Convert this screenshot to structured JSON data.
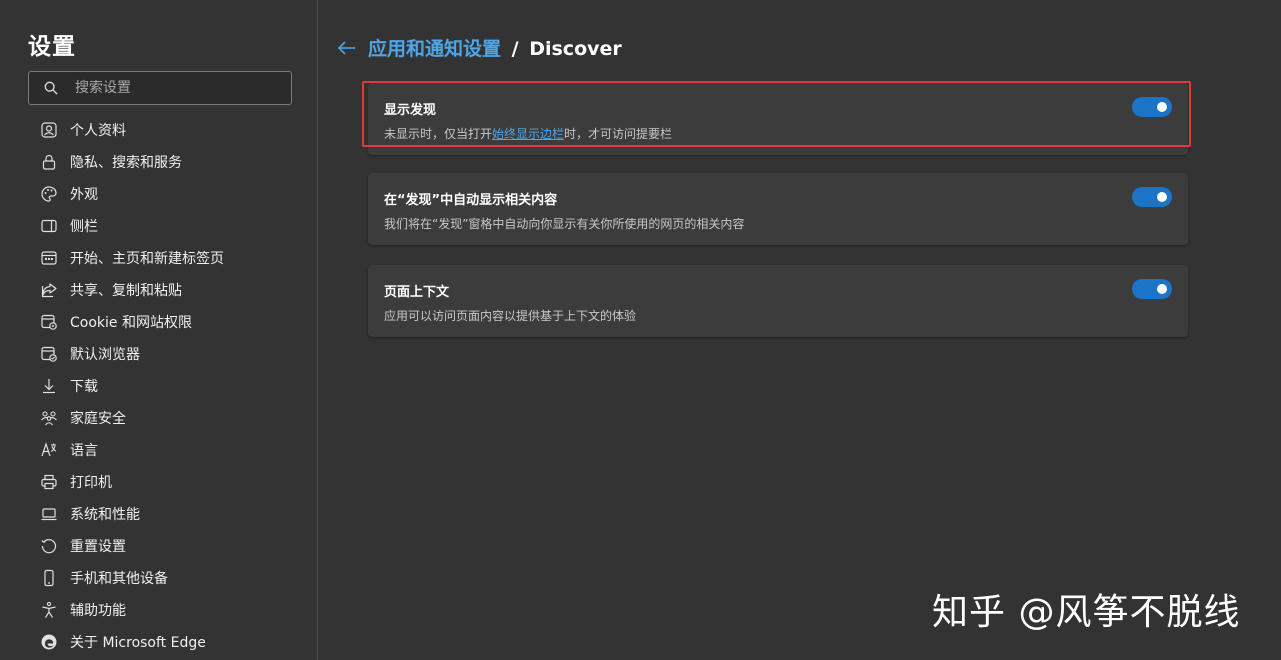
{
  "sidebar": {
    "title": "设置",
    "search": {
      "placeholder": "搜索设置",
      "value": ""
    },
    "items": [
      {
        "label": "个人资料",
        "icon": "profile-icon"
      },
      {
        "label": "隐私、搜索和服务",
        "icon": "lock-icon"
      },
      {
        "label": "外观",
        "icon": "palette-icon"
      },
      {
        "label": "侧栏",
        "icon": "sidebar-icon"
      },
      {
        "label": "开始、主页和新建标签页",
        "icon": "home-icon"
      },
      {
        "label": "共享、复制和粘贴",
        "icon": "share-icon"
      },
      {
        "label": "Cookie 和网站权限",
        "icon": "cookie-icon"
      },
      {
        "label": "默认浏览器",
        "icon": "browser-icon"
      },
      {
        "label": "下载",
        "icon": "download-icon"
      },
      {
        "label": "家庭安全",
        "icon": "family-icon"
      },
      {
        "label": "语言",
        "icon": "language-icon"
      },
      {
        "label": "打印机",
        "icon": "printer-icon"
      },
      {
        "label": "系统和性能",
        "icon": "laptop-icon"
      },
      {
        "label": "重置设置",
        "icon": "reset-icon"
      },
      {
        "label": "手机和其他设备",
        "icon": "phone-icon"
      },
      {
        "label": "辅助功能",
        "icon": "accessibility-icon"
      },
      {
        "label": "关于 Microsoft Edge",
        "icon": "edge-icon"
      }
    ]
  },
  "header": {
    "back_icon": "back-arrow-icon",
    "breadcrumb_parent": "应用和通知设置",
    "separator": "/",
    "breadcrumb_current": "Discover"
  },
  "cards": [
    {
      "title": "显示发现",
      "desc_prefix": "未显示时，仅当打开",
      "desc_link": "始终显示边栏",
      "desc_suffix": "时，才可访问提要栏",
      "toggle_on": true
    },
    {
      "title": "在“发现”中自动显示相关内容",
      "desc": "我们将在“发现”窗格中自动向你显示有关你所使用的网页的相关内容",
      "toggle_on": true
    },
    {
      "title": "页面上下文",
      "desc": "应用可以访问页面内容以提供基于上下文的体验",
      "toggle_on": true
    }
  ],
  "watermark": "知乎 @风筝不脱线",
  "colors": {
    "background": "#333333",
    "card": "#3c3c3c",
    "accent": "#4ea6e6",
    "toggle_on": "#1b74c7",
    "highlight": "#e03b3b"
  }
}
